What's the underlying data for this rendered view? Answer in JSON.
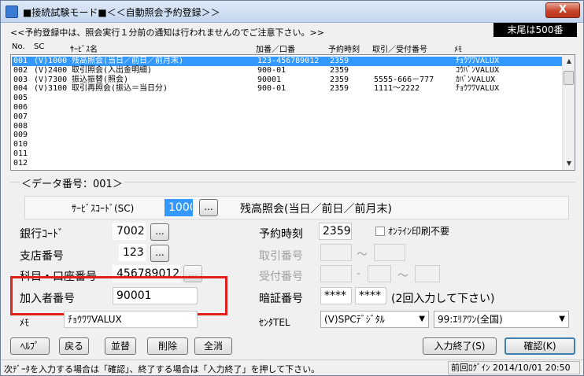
{
  "window": {
    "title": "■接続試験モード■＜＜自動照会予約登録＞＞",
    "close": "X"
  },
  "notice": "<<予約登録中は、照会実行１分前の通知は行われませんのでご注意下さい。>>",
  "tail_badge": "末尾は500番",
  "table": {
    "headers": [
      "No.",
      "SC",
      "ｻｰﾋﾞｽ名",
      "加番／口番",
      "予約時刻",
      "取引／受付番号",
      "ﾒﾓ"
    ],
    "rows": [
      {
        "no": "001",
        "sc": "(V)1000",
        "name": "残高照会(当日／前日／前月末)",
        "acct": "123-456789012",
        "time": "2359",
        "txn": "",
        "memo": "ﾁｮｳﾜﾜVALUX"
      },
      {
        "no": "002",
        "sc": "(V)2400",
        "name": "取引照会(入出金明細)",
        "acct": "900-01",
        "time": "2359",
        "txn": "",
        "memo": "ｺｳﾊﾞﾝVALUX"
      },
      {
        "no": "003",
        "sc": "(V)7300",
        "name": "振込振替(照会)",
        "acct": "90001",
        "time": "2359",
        "txn": "5555-666－777",
        "memo": "ｶﾊﾞﾝVALUX"
      },
      {
        "no": "004",
        "sc": "(V)3100",
        "name": "取引再照会(振込＝当日分)",
        "acct": "900-01",
        "time": "2359",
        "txn": "1111～2222",
        "memo": "ﾁｮｳﾜﾜVALUX"
      },
      {
        "no": "005",
        "sc": "",
        "name": "",
        "acct": "",
        "time": "",
        "txn": "",
        "memo": ""
      },
      {
        "no": "006",
        "sc": "",
        "name": "",
        "acct": "",
        "time": "",
        "txn": "",
        "memo": ""
      },
      {
        "no": "007",
        "sc": "",
        "name": "",
        "acct": "",
        "time": "",
        "txn": "",
        "memo": ""
      },
      {
        "no": "008",
        "sc": "",
        "name": "",
        "acct": "",
        "time": "",
        "txn": "",
        "memo": ""
      },
      {
        "no": "009",
        "sc": "",
        "name": "",
        "acct": "",
        "time": "",
        "txn": "",
        "memo": ""
      },
      {
        "no": "010",
        "sc": "",
        "name": "",
        "acct": "",
        "time": "",
        "txn": "",
        "memo": ""
      },
      {
        "no": "011",
        "sc": "",
        "name": "",
        "acct": "",
        "time": "",
        "txn": "",
        "memo": ""
      },
      {
        "no": "012",
        "sc": "",
        "name": "",
        "acct": "",
        "time": "",
        "txn": "",
        "memo": ""
      }
    ]
  },
  "detail": {
    "group_label": "＜データ番号：001＞",
    "service_code_label": "ｻｰﾋﾞｽｺｰﾄﾞ(SC)",
    "service_code": "1000",
    "service_name": "残高照会(当日／前日／前月末)",
    "bank_code_label": "銀行ｺｰﾄﾞ",
    "bank_code": "7002",
    "branch_label": "支店番号",
    "branch": "123",
    "account_label": "科目・口座番号",
    "account": "456789012",
    "member_label": "加入者番号",
    "member": "90001",
    "memo_label": "ﾒﾓ",
    "memo": "ﾁｮｳﾜﾜVALUX",
    "time_label": "予約時刻",
    "time": "2359",
    "online_print_label": "ｵﾝﾗｲﾝ印刷不要",
    "txn_label": "取引番号",
    "tilde": "～",
    "receipt_label": "受付番号",
    "dash": "-",
    "pin_label": "暗証番号",
    "pin1": "****",
    "pin2": "****",
    "pin_hint": "(2回入力して下さい)",
    "center_label": "ｾﾝﾀTEL",
    "center_select": "(V)SPCﾃﾞｼﾞﾀﾙ",
    "area_select": "99:ｴﾘｱﾜﾝ(全国)",
    "dots": "..."
  },
  "buttons": {
    "help": "ﾍﾙﾌﾟ",
    "back": "戻る",
    "sort": "並替",
    "delete": "削除",
    "clear_all": "全消",
    "finish_input": "入力終了(S)",
    "confirm": "確認(K)"
  },
  "status": {
    "message": "次ﾃﾞｰﾀを入力する場合は「確認」、終了する場合は「入力終了」を押して下さい。",
    "last_login": "前回ﾛｸﾞｲﾝ 2014/10/01 20:50"
  }
}
